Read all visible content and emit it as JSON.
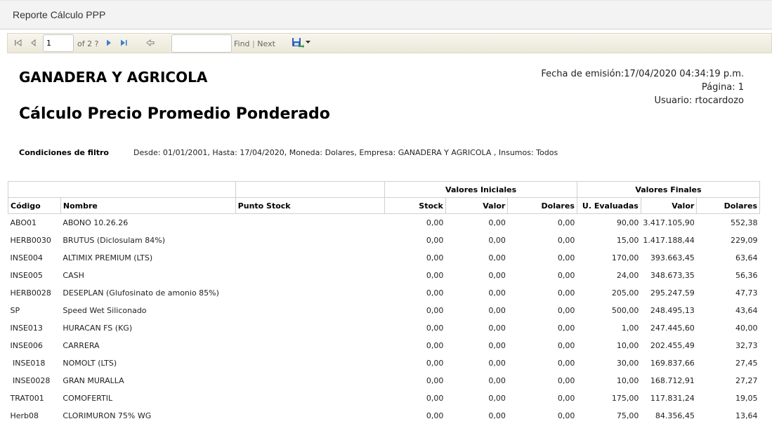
{
  "window": {
    "title": "Reporte Cálculo PPP"
  },
  "toolbar": {
    "page_value": "1",
    "of_pages": "of 2 ?",
    "find_label": "Find",
    "separator": "|",
    "next_label": "Next",
    "icons": [
      "first-page-icon",
      "prev-page-icon",
      "next-page-icon",
      "last-page-icon",
      "back-icon",
      "export-save-icon",
      "dropdown-arrow-icon"
    ]
  },
  "report": {
    "company": "GANADERA Y AGRICOLA",
    "title": "Cálculo Precio Promedio Ponderado",
    "meta": {
      "fecha": "Fecha de emisión:17/04/2020 04:34:19 p.m.",
      "pagina": "Página: 1",
      "usuario": "Usuario: rtocardozo"
    },
    "filter_label": "Condiciones de filtro",
    "filter_value": "Desde: 01/01/2001, Hasta: 17/04/2020, Moneda: Dolares, Empresa: GANADERA Y AGRICOLA , Insumos: Todos"
  },
  "table": {
    "group_headers": {
      "iniciales": "Valores Iniciales",
      "finales": "Valores Finales"
    },
    "columns": [
      "Código",
      "Nombre",
      "Punto Stock",
      "Stock",
      "Valor",
      "Dolares",
      "U. Evaluadas",
      "Valor",
      "Dolares"
    ],
    "rows": [
      [
        "ABO01",
        "ABONO 10.26.26",
        "",
        "0,00",
        "0,00",
        "0,00",
        "90,00",
        "3.417.105,90",
        "552,38"
      ],
      [
        "HERB0030",
        "BRUTUS (Diclosulam 84%)",
        "",
        "0,00",
        "0,00",
        "0,00",
        "15,00",
        "1.417.188,44",
        "229,09"
      ],
      [
        "INSE004",
        "ALTIMIX PREMIUM (LTS)",
        "",
        "0,00",
        "0,00",
        "0,00",
        "170,00",
        "393.663,45",
        "63,64"
      ],
      [
        "INSE005",
        "CASH",
        "",
        "0,00",
        "0,00",
        "0,00",
        "24,00",
        "348.673,35",
        "56,36"
      ],
      [
        "HERB0028",
        "DESEPLAN (Glufosinato de amonio 85%)",
        "",
        "0,00",
        "0,00",
        "0,00",
        "205,00",
        "295.247,59",
        "47,73"
      ],
      [
        "SP",
        "Speed Wet Siliconado",
        "",
        "0,00",
        "0,00",
        "0,00",
        "500,00",
        "248.495,13",
        "43,64"
      ],
      [
        "INSE013",
        "HURACAN FS (KG)",
        "",
        "0,00",
        "0,00",
        "0,00",
        "1,00",
        "247.445,60",
        "40,00"
      ],
      [
        "INSE006",
        "CARRERA",
        "",
        "0,00",
        "0,00",
        "0,00",
        "10,00",
        "202.455,49",
        "32,73"
      ],
      [
        " INSE018",
        "NOMOLT (LTS)",
        "",
        "0,00",
        "0,00",
        "0,00",
        "30,00",
        "169.837,66",
        "27,45"
      ],
      [
        " INSE0028",
        "GRAN MURALLA",
        "",
        "0,00",
        "0,00",
        "0,00",
        "10,00",
        "168.712,91",
        "27,27"
      ],
      [
        "TRAT001",
        "COMOFERTIL",
        "",
        "0,00",
        "0,00",
        "0,00",
        "175,00",
        "117.831,24",
        "19,05"
      ],
      [
        "Herb08",
        "CLORIMURON 75% WG",
        "",
        "0,00",
        "0,00",
        "0,00",
        "75,00",
        "84.356,45",
        "13,64"
      ]
    ]
  }
}
